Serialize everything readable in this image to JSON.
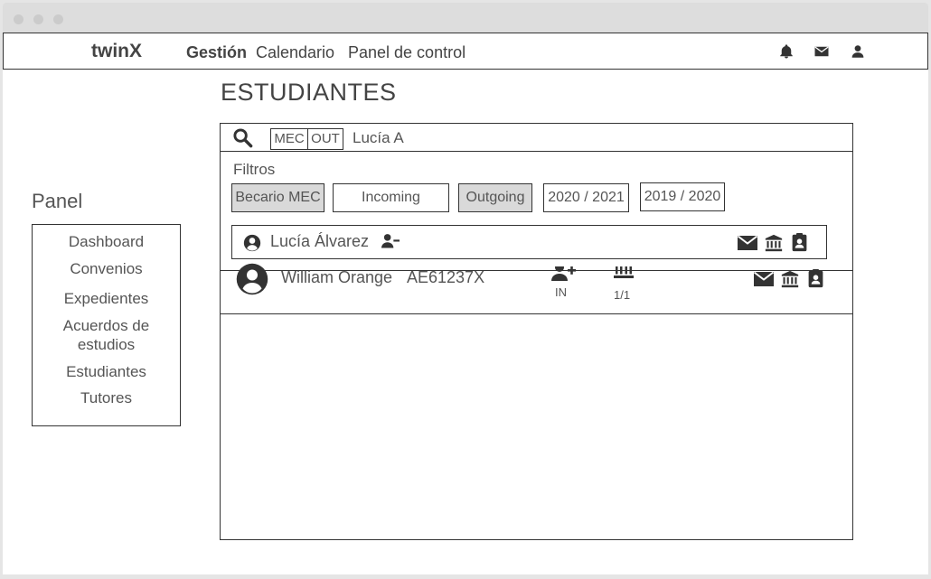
{
  "app": {
    "brand": "twinX",
    "nav": [
      {
        "label": "Gestión"
      },
      {
        "label": "Calendario"
      },
      {
        "label": "Panel de control"
      }
    ],
    "icons": [
      "bell-icon",
      "mail-icon",
      "user-icon"
    ]
  },
  "page": {
    "title": "ESTUDIANTES"
  },
  "sidebar": {
    "title": "Panel",
    "items": [
      {
        "label": "Dashboard"
      },
      {
        "label": "Convenios"
      },
      {
        "label": "Expedientes"
      },
      {
        "label": "Acuerdos de estudios"
      },
      {
        "label": "Estudiantes"
      },
      {
        "label": "Tutores"
      }
    ]
  },
  "search": {
    "toggles": [
      "MEC",
      "OUT"
    ],
    "value": "Lucía A"
  },
  "filters": {
    "label": "Filtros",
    "chips": [
      {
        "label": "Becario MEC",
        "selected": true
      },
      {
        "label": "Incoming",
        "selected": false
      },
      {
        "label": "Outgoing",
        "selected": true
      },
      {
        "label": "2020 / 2021",
        "selected": false
      },
      {
        "label": "2019 / 2020",
        "selected": false
      }
    ]
  },
  "suggestion": {
    "name": "Lucía Álvarez",
    "icons": [
      "user-circle-icon",
      "user-minus-icon",
      "mail-icon",
      "university-icon",
      "id-badge-icon"
    ]
  },
  "students": [
    {
      "name": "William Orange",
      "id": "AE61237X",
      "direction": "IN",
      "agreements": "1/1"
    }
  ]
}
